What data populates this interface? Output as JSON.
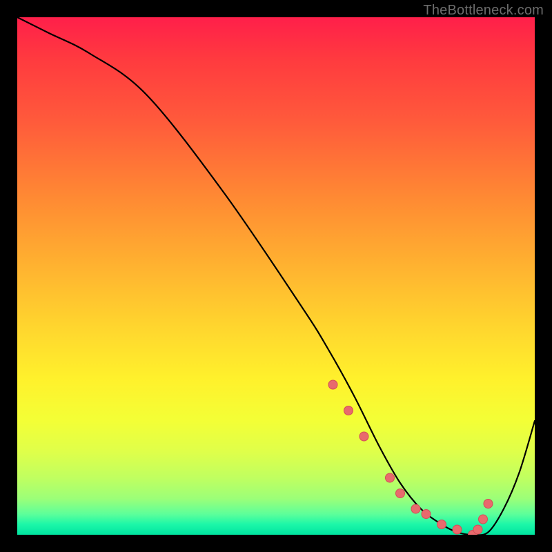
{
  "watermark": "TheBottleneck.com",
  "colors": {
    "curve": "#000000",
    "marker_fill": "#e86a6d",
    "marker_stroke": "#d44d57",
    "frame": "#000000"
  },
  "chart_data": {
    "type": "line",
    "title": "",
    "xlabel": "",
    "ylabel": "",
    "xlim": [
      0,
      100
    ],
    "ylim": [
      0,
      100
    ],
    "grid": false,
    "legend": false,
    "series": [
      {
        "name": "curve",
        "x": [
          0,
          6,
          14,
          25,
          40,
          55,
          60,
          65,
          70,
          74,
          78,
          82,
          85,
          88,
          91,
          94,
          97,
          100
        ],
        "values": [
          100,
          97,
          93,
          85,
          66,
          44,
          36,
          27,
          17,
          10,
          5,
          2,
          0.5,
          0,
          0.5,
          5,
          12,
          22
        ]
      }
    ],
    "markers": {
      "name": "highlight-points",
      "x": [
        61,
        64,
        67,
        72,
        74,
        77,
        79,
        82,
        85,
        88,
        89,
        90,
        91
      ],
      "values": [
        29,
        24,
        19,
        11,
        8,
        5,
        4,
        2,
        1,
        0,
        1,
        3,
        6
      ]
    }
  }
}
